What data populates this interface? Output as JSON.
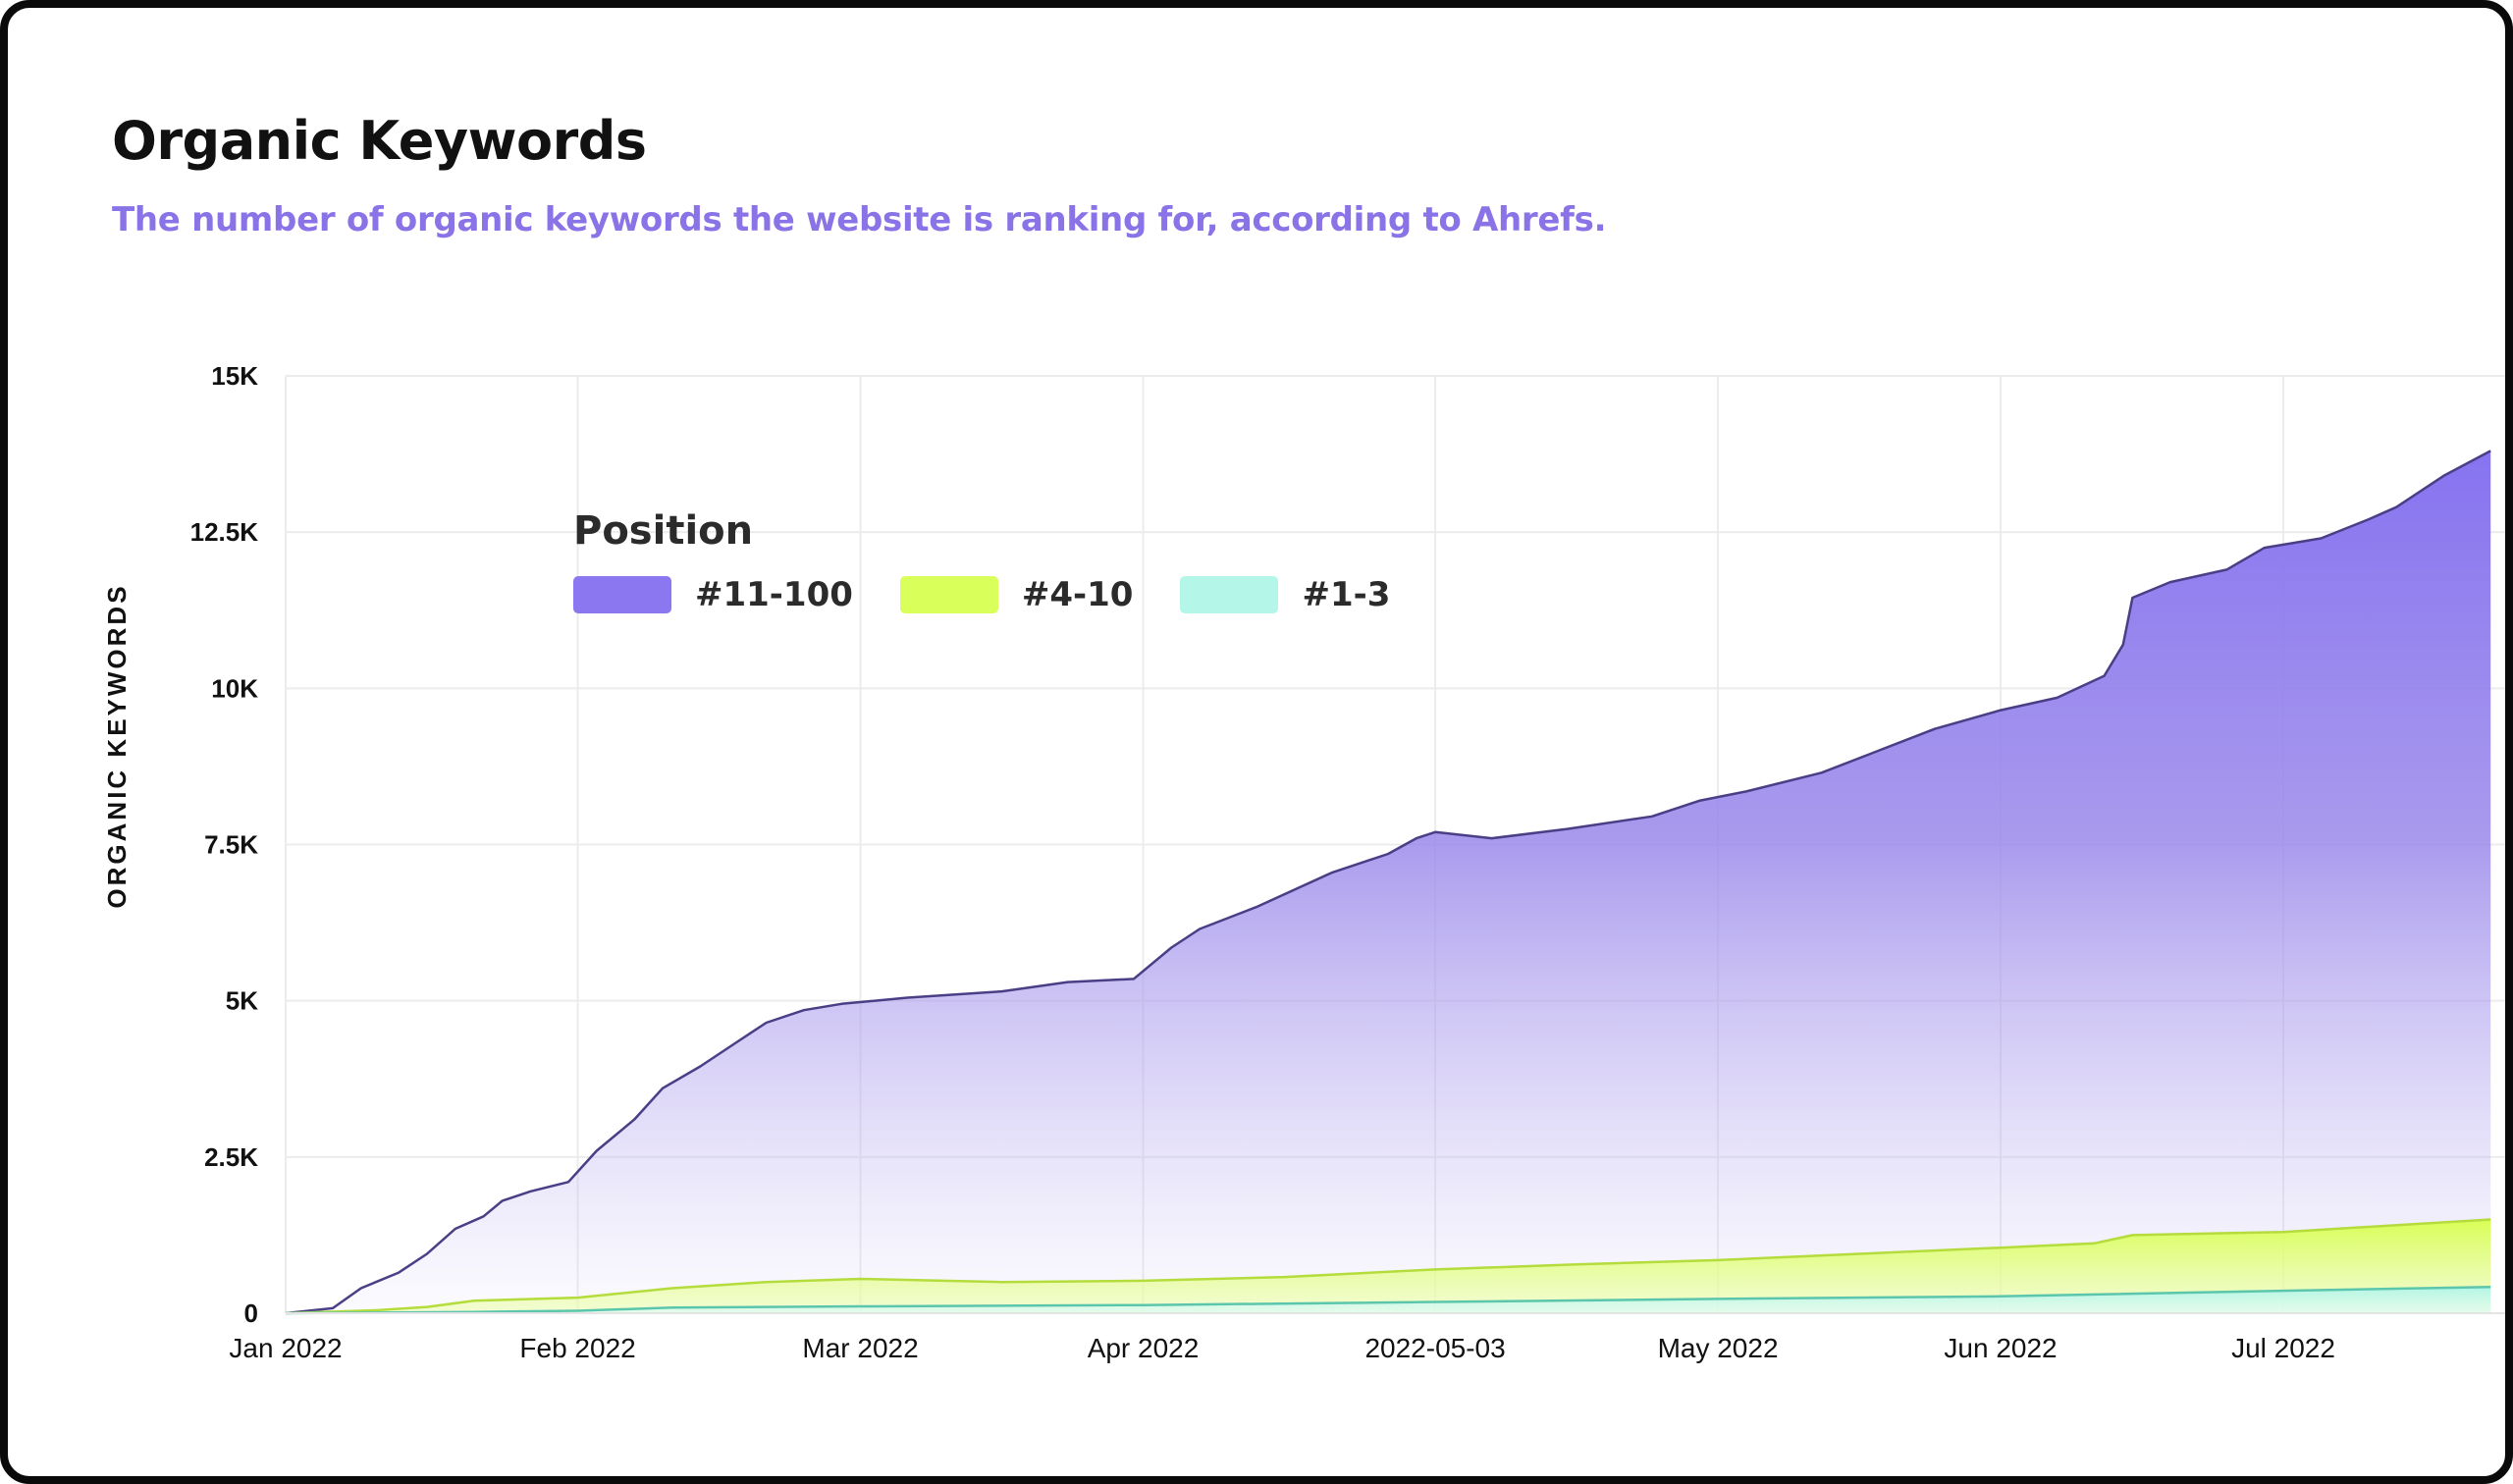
{
  "header": {
    "title": "Organic Keywords",
    "subtitle": "The number of organic keywords the website is ranking for, according to Ahrefs."
  },
  "chart_data": {
    "type": "area",
    "title": "Organic Keywords",
    "subtitle": "The number of organic keywords the website is ranking for, according to Ahrefs.",
    "ylabel": "ORGANIC KEYWORDS",
    "xlabel": "",
    "ylim": [
      0,
      15000
    ],
    "yticks": [
      {
        "value": 0,
        "label": "0"
      },
      {
        "value": 2500,
        "label": "2.5K"
      },
      {
        "value": 5000,
        "label": "5K"
      },
      {
        "value": 7500,
        "label": "7.5K"
      },
      {
        "value": 10000,
        "label": "10K"
      },
      {
        "value": 12500,
        "label": "12.5K"
      },
      {
        "value": 15000,
        "label": "15K"
      }
    ],
    "xlim": [
      "2022-01-01",
      "2022-07-24"
    ],
    "xticks": [
      {
        "date": "2022-01-01",
        "label": "Jan 2022"
      },
      {
        "date": "2022-02-01",
        "label": "Feb 2022"
      },
      {
        "date": "2022-03-03",
        "label": "Mar 2022"
      },
      {
        "date": "2022-04-02",
        "label": "Apr 2022"
      },
      {
        "date": "2022-05-03",
        "label": "2022-05-03"
      },
      {
        "date": "2022-06-02",
        "label": "May 2022"
      },
      {
        "date": "2022-07-02",
        "label": "Jun 2022"
      },
      {
        "date": "2022-08-01",
        "label": "Jul 2022"
      }
    ],
    "grid": true,
    "stacked": false,
    "legend": {
      "title": "Position",
      "placement": "top-left"
    },
    "series": [
      {
        "name": "#11-100",
        "color": "#8b77f0",
        "points": [
          [
            "2022-01-01",
            0
          ],
          [
            "2022-01-06",
            80
          ],
          [
            "2022-01-09",
            400
          ],
          [
            "2022-01-13",
            650
          ],
          [
            "2022-01-16",
            950
          ],
          [
            "2022-01-19",
            1350
          ],
          [
            "2022-01-22",
            1550
          ],
          [
            "2022-01-24",
            1800
          ],
          [
            "2022-01-27",
            1950
          ],
          [
            "2022-01-31",
            2100
          ],
          [
            "2022-02-03",
            2600
          ],
          [
            "2022-02-07",
            3100
          ],
          [
            "2022-02-10",
            3600
          ],
          [
            "2022-02-14",
            3950
          ],
          [
            "2022-02-18",
            4350
          ],
          [
            "2022-02-21",
            4650
          ],
          [
            "2022-02-25",
            4850
          ],
          [
            "2022-03-01",
            4950
          ],
          [
            "2022-03-08",
            5050
          ],
          [
            "2022-03-18",
            5150
          ],
          [
            "2022-03-25",
            5300
          ],
          [
            "2022-04-01",
            5350
          ],
          [
            "2022-04-05",
            5850
          ],
          [
            "2022-04-08",
            6150
          ],
          [
            "2022-04-14",
            6500
          ],
          [
            "2022-04-22",
            7050
          ],
          [
            "2022-04-28",
            7350
          ],
          [
            "2022-05-01",
            7600
          ],
          [
            "2022-05-03",
            7700
          ],
          [
            "2022-05-09",
            7600
          ],
          [
            "2022-05-17",
            7750
          ],
          [
            "2022-05-26",
            7950
          ],
          [
            "2022-05-31",
            8200
          ],
          [
            "2022-06-05",
            8350
          ],
          [
            "2022-06-13",
            8650
          ],
          [
            "2022-06-19",
            9000
          ],
          [
            "2022-06-25",
            9350
          ],
          [
            "2022-07-02",
            9650
          ],
          [
            "2022-07-08",
            9850
          ],
          [
            "2022-07-13",
            10200
          ],
          [
            "2022-07-15",
            10700
          ],
          [
            "2022-07-16",
            11450
          ],
          [
            "2022-07-20",
            11700
          ],
          [
            "2022-07-26",
            11900
          ],
          [
            "2022-07-30",
            12250
          ],
          [
            "2022-08-05",
            12400
          ],
          [
            "2022-08-10",
            12700
          ],
          [
            "2022-08-13",
            12900
          ],
          [
            "2022-08-18",
            13400
          ],
          [
            "2022-08-23",
            13800
          ]
        ]
      },
      {
        "name": "#4-10",
        "color": "#d8ff5a",
        "points": [
          [
            "2022-01-01",
            0
          ],
          [
            "2022-01-11",
            50
          ],
          [
            "2022-01-16",
            100
          ],
          [
            "2022-01-21",
            200
          ],
          [
            "2022-02-01",
            250
          ],
          [
            "2022-02-11",
            400
          ],
          [
            "2022-02-21",
            500
          ],
          [
            "2022-03-03",
            550
          ],
          [
            "2022-03-18",
            500
          ],
          [
            "2022-04-02",
            520
          ],
          [
            "2022-04-17",
            580
          ],
          [
            "2022-05-03",
            700
          ],
          [
            "2022-05-18",
            780
          ],
          [
            "2022-06-02",
            850
          ],
          [
            "2022-06-17",
            950
          ],
          [
            "2022-07-02",
            1050
          ],
          [
            "2022-07-12",
            1120
          ],
          [
            "2022-07-16",
            1250
          ],
          [
            "2022-08-01",
            1300
          ],
          [
            "2022-08-23",
            1500
          ]
        ]
      },
      {
        "name": "#1-3",
        "color": "#b4f6e8",
        "points": [
          [
            "2022-01-01",
            0
          ],
          [
            "2022-01-21",
            20
          ],
          [
            "2022-02-01",
            40
          ],
          [
            "2022-02-11",
            90
          ],
          [
            "2022-03-03",
            110
          ],
          [
            "2022-04-02",
            130
          ],
          [
            "2022-05-03",
            180
          ],
          [
            "2022-06-02",
            230
          ],
          [
            "2022-07-02",
            270
          ],
          [
            "2022-08-01",
            360
          ],
          [
            "2022-08-23",
            420
          ]
        ]
      }
    ]
  }
}
